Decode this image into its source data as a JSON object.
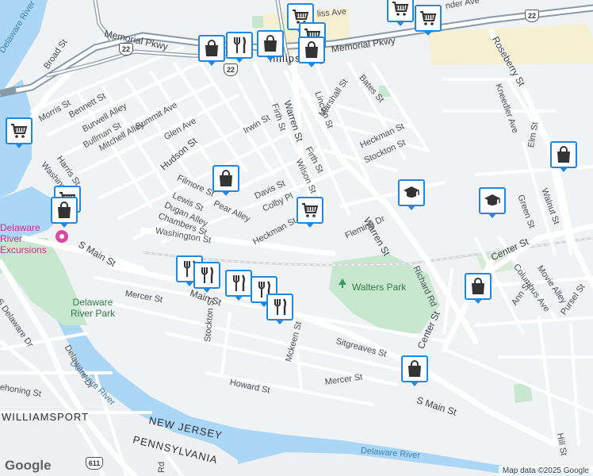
{
  "streets": {
    "memorial_pkwy_w": "Memorial Pkwy",
    "memorial_pkwy_e": "Memorial Pkwy",
    "broad_st": "Broad St",
    "morris_st": "Morris St",
    "bennett_st": "Bennett St",
    "burwell_alley": "Burwell Alley",
    "bullman_st": "Bullman St",
    "mitchell_alley": "Mitchell Alley",
    "summit_ave": "Summit Ave",
    "glen_ave": "Glen Ave",
    "hudson_st": "Hudson St",
    "irwin_st": "Irwin St",
    "firth_st_1": "Firth St",
    "firth_st_2": "Firth St",
    "warren_st_1": "Warren St",
    "warren_st_2": "Warren St",
    "lincoln_st": "Lincoln St",
    "marshall_st": "Marshall St",
    "bates_st": "Bates St",
    "heckman_st_1": "Heckman St",
    "heckman_st_2": "Heckman St",
    "stockton_st_1": "Stockton St",
    "stockton_st_2": "Stockton St",
    "wilson_st": "Wilson St",
    "davis_st": "Davis St",
    "colby_pl": "Colby Pl",
    "filmore_st": "Filmore St",
    "pear_alley": "Pear Alley",
    "lewis_st": "Lewis St",
    "dugan_alley": "Dugan Alley",
    "chambers_st": "Chambers St",
    "washington_st_1": "Washington St",
    "washington_st_2": "Washington St",
    "harris_st": "Harris St",
    "s_main_st_1": "S Main St",
    "s_main_st_2": "S Main St",
    "main_st": "Main St",
    "mercer_st_1": "Mercer St",
    "mercer_st_2": "Mercer St",
    "howard_st": "Howard St",
    "mckeen_st": "Mckeen St",
    "sitgreaves_st": "Sitgreaves St",
    "fleming_dr": "Fleming Dr",
    "richard_rd": "Richard Rd",
    "center_st_1": "Center St",
    "center_st_2": "Center St",
    "roseberry_st": "Roseberry St",
    "kneedler_ave": "Kneedler Ave",
    "elm_st": "Elm St",
    "walnut_st": "Walnut St",
    "green_st": "Green St",
    "columbus_ave": "Columbus Ave",
    "movie_alley": "Movie Alley",
    "ann_st": "Ann St",
    "pursel_st": "Pursel St",
    "hill_st": "Hill St",
    "s_delaware_dr": "S Delaware Dr",
    "delaware_dr": "Delaware Dr",
    "ehoning_st": "ehoning St",
    "rd_stub": "Rd",
    "bliss_ave": "liss Ave",
    "fender_ave": "nder Ave"
  },
  "water": {
    "delaware_river_1": "Delaware River",
    "delaware_river_2": "Delaware River",
    "delaware_river_3": "Delaware River"
  },
  "parks": {
    "delaware_river_park": "Delaware River Park",
    "walters_park": "Walters Park"
  },
  "places": {
    "phillipsburg": "hillipsburg",
    "williamsport": "WILLIAMSPORT",
    "new_jersey": "NEW JERSEY",
    "pennsylvania": "PENNSYLVANIA",
    "excursions": "Delaware River Excursions"
  },
  "shields": {
    "route22_a": "22",
    "route22_b": "22",
    "route22_c": "22",
    "route611": "611"
  },
  "attribution": {
    "logo": "Google",
    "credit": "Map data ©2025 Google"
  },
  "colors": {
    "marker_border": "#1e88e5",
    "water": "#a9d7f5",
    "park": "#c8e7cf",
    "highway": "#ffffff",
    "freeway": "#8a99a8"
  },
  "markers": [
    {
      "id": "m1",
      "icon": "grocery-icon"
    },
    {
      "id": "m2",
      "icon": "grocery-icon"
    },
    {
      "id": "m3",
      "icon": "grocery-icon"
    },
    {
      "id": "m4",
      "icon": "shopping-bag-icon"
    },
    {
      "id": "m5",
      "icon": "restaurant-icon"
    },
    {
      "id": "m6",
      "icon": "shopping-bag-icon"
    },
    {
      "id": "m7",
      "icon": "grocery-icon"
    },
    {
      "id": "m8",
      "icon": "shopping-bag-icon"
    },
    {
      "id": "m9",
      "icon": "grocery-icon"
    },
    {
      "id": "m10",
      "icon": "shopping-bag-icon"
    },
    {
      "id": "m11",
      "icon": "grocery-icon"
    },
    {
      "id": "m12",
      "icon": "shopping-bag-icon"
    },
    {
      "id": "m13",
      "icon": "shopping-bag-icon"
    },
    {
      "id": "m14",
      "icon": "grocery-icon"
    },
    {
      "id": "m15",
      "icon": "school-icon"
    },
    {
      "id": "m16",
      "icon": "school-icon"
    },
    {
      "id": "m17",
      "icon": "restaurant-icon"
    },
    {
      "id": "m18",
      "icon": "restaurant-icon"
    },
    {
      "id": "m19",
      "icon": "restaurant-icon"
    },
    {
      "id": "m20",
      "icon": "restaurant-icon"
    },
    {
      "id": "m21",
      "icon": "restaurant-icon"
    },
    {
      "id": "m22",
      "icon": "shopping-bag-icon"
    },
    {
      "id": "m23",
      "icon": "shopping-bag-icon"
    }
  ]
}
